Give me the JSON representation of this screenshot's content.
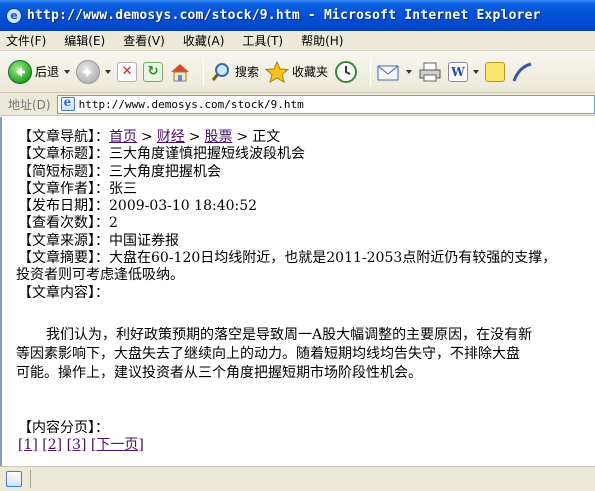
{
  "window": {
    "title": "http://www.demosys.com/stock/9.htm - Microsoft Internet Explorer",
    "icon": "ie-icon"
  },
  "menu": [
    "文件(F)",
    "编辑(E)",
    "查看(V)",
    "收藏(A)",
    "工具(T)",
    "帮助(H)"
  ],
  "toolbar": {
    "back_label": "后退",
    "search_label": "搜索",
    "favorites_label": "收藏夹"
  },
  "address": {
    "label": "地址(D)",
    "url": "http://www.demosys.com/stock/9.htm"
  },
  "article": {
    "nav_label": "【文章导航】：",
    "nav_home": "首页",
    "nav_finance": "财经",
    "nav_stock": "股票",
    "nav_current": "正文",
    "title_label": "【文章标题】：",
    "title_value": "三大角度谨慎把握短线波段机会",
    "short_title_label": "【简短标题】：",
    "short_title_value": "三大角度把握机会",
    "author_label": "【文章作者】：",
    "author_value": "张三",
    "date_label": "【发布日期】：",
    "date_value": "2009-03-10 18:40:52",
    "views_label": "【查看次数】：",
    "views_value": "2",
    "source_label": "【文章来源】：",
    "source_value": "中国证券报",
    "summary_label": "【文章摘要】：",
    "summary_line1": "大盘在60-120日均线附近，也就是2011-2053点附近仍有较强的支撑，",
    "summary_line2": "投资者则可考虑逢低吸纳。",
    "content_label": "【文章内容】：",
    "content_line1": "　　我们认为，利好政策预期的落空是导致周一A股大幅调整的主要原因，在没有新",
    "content_line2": "等因素影响下，大盘失去了继续向上的动力。随着短期均线均告失守，不排除大盘",
    "content_line3": "可能。操作上，建议投资者从三个角度把握短期市场阶段性机会。",
    "pager_label": "【内容分页】：",
    "pages": [
      "[1]",
      "[2]",
      "[3]",
      "[下一页]"
    ]
  }
}
